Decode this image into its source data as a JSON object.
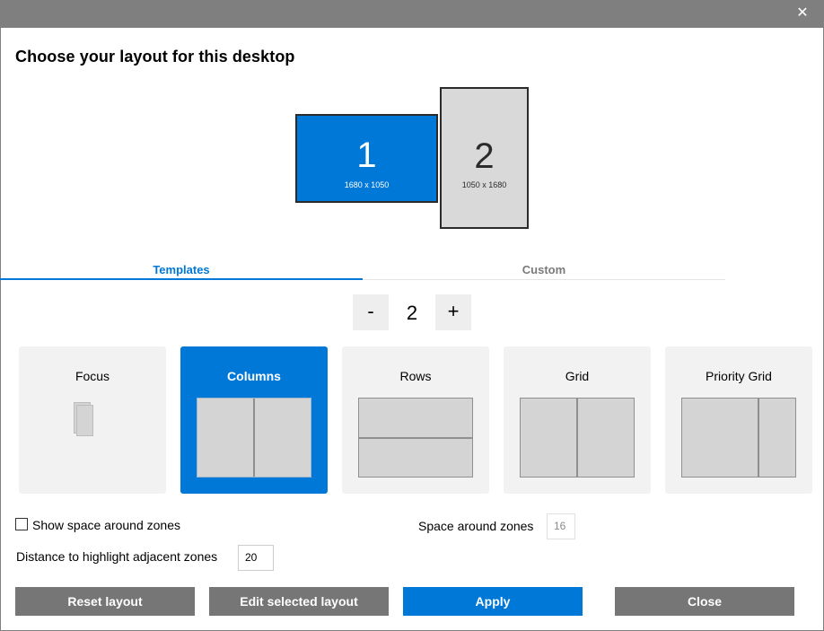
{
  "window": {
    "close_glyph": "✕",
    "close_icon": "close-icon"
  },
  "heading": "Choose your layout for this desktop",
  "monitors": [
    {
      "number": "1",
      "resolution": "1680 x 1050",
      "selected": true,
      "color": "#0078d7"
    },
    {
      "number": "2",
      "resolution": "1050 x 1680",
      "selected": false,
      "color": "#d9d9d9"
    }
  ],
  "tabs": {
    "templates": "Templates",
    "custom": "Custom",
    "active": "Templates"
  },
  "zone_stepper": {
    "minus": "-",
    "value": "2",
    "plus": "+"
  },
  "layouts": [
    {
      "label": "Focus",
      "selected": false
    },
    {
      "label": "Columns",
      "selected": true
    },
    {
      "label": "Rows",
      "selected": false
    },
    {
      "label": "Grid",
      "selected": false
    },
    {
      "label": "Priority Grid",
      "selected": false
    }
  ],
  "options": {
    "show_space_label": "Show space around zones",
    "show_space_checked": false,
    "space_around_label": "Space around zones",
    "space_around_value": "16",
    "distance_label": "Distance to highlight adjacent zones",
    "distance_value": "20"
  },
  "buttons": {
    "reset": "Reset layout",
    "edit": "Edit selected layout",
    "apply": "Apply",
    "close": "Close"
  },
  "colors": {
    "accent": "#0078d7",
    "button_grey": "#767676",
    "titlebar": "#7f7f7f"
  }
}
